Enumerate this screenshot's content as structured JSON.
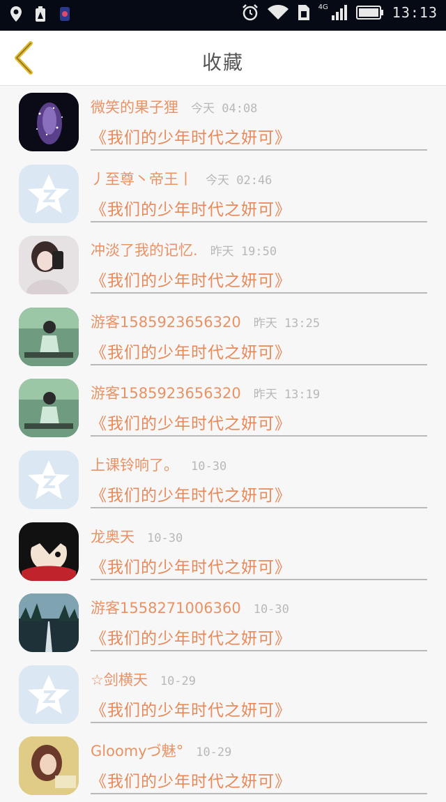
{
  "status_bar": {
    "network": "4G",
    "time": "13:13"
  },
  "header": {
    "title": "收藏",
    "back_icon": "chevron-left-icon"
  },
  "colors": {
    "accent": "#e8895a",
    "back_arrow": "#e2b92a",
    "time_text": "#b8b8b8"
  },
  "favorites": [
    {
      "name": "微笑的果子狸",
      "time": "今天 04:08",
      "song": "《我们的少年时代之妍可》",
      "avatar": "galaxy-avatar"
    },
    {
      "name": "丿至尊丶帝王丨",
      "time": "今天 02:46",
      "song": "《我们的少年时代之妍可》",
      "avatar": "qq-default-avatar"
    },
    {
      "name": "冲淡了我的记忆.",
      "time": "昨天 19:50",
      "song": "《我们的少年时代之妍可》",
      "avatar": "girl-photo-avatar"
    },
    {
      "name": "游客1585923656320",
      "time": "昨天 13:25",
      "song": "《我们的少年时代之妍可》",
      "avatar": "green-photo-avatar"
    },
    {
      "name": "游客1585923656320",
      "time": "昨天 13:19",
      "song": "《我们的少年时代之妍可》",
      "avatar": "green-photo-avatar"
    },
    {
      "name": "上课铃响了。",
      "time": "10-30",
      "song": "《我们的少年时代之妍可》",
      "avatar": "qq-default-avatar"
    },
    {
      "name": "龙奥天",
      "time": "10-30",
      "song": "《我们的少年时代之妍可》",
      "avatar": "cartoon-avatar"
    },
    {
      "name": "游客1558271006360",
      "time": "10-30",
      "song": "《我们的少年时代之妍可》",
      "avatar": "road-photo-avatar"
    },
    {
      "name": "☆剑横天",
      "time": "10-29",
      "song": "《我们的少年时代之妍可》",
      "avatar": "qq-default-avatar"
    },
    {
      "name": "Gloomyづ魅°",
      "time": "10-29",
      "song": "《我们的少年时代之妍可》",
      "avatar": "gloomy-photo-avatar"
    }
  ]
}
